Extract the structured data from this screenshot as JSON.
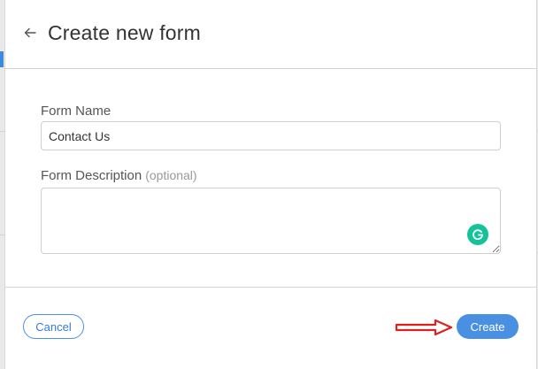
{
  "dialog": {
    "title": "Create new form",
    "back_icon": "arrow-left-icon"
  },
  "form": {
    "name_label": "Form Name",
    "name_value": "Contact Us",
    "description_label": "Form Description",
    "description_optional": "(optional)",
    "description_value": ""
  },
  "footer": {
    "cancel_label": "Cancel",
    "create_label": "Create"
  },
  "colors": {
    "accent": "#4a90e2",
    "annotation_arrow": "#e02020",
    "grammarly": "#15c39a"
  }
}
